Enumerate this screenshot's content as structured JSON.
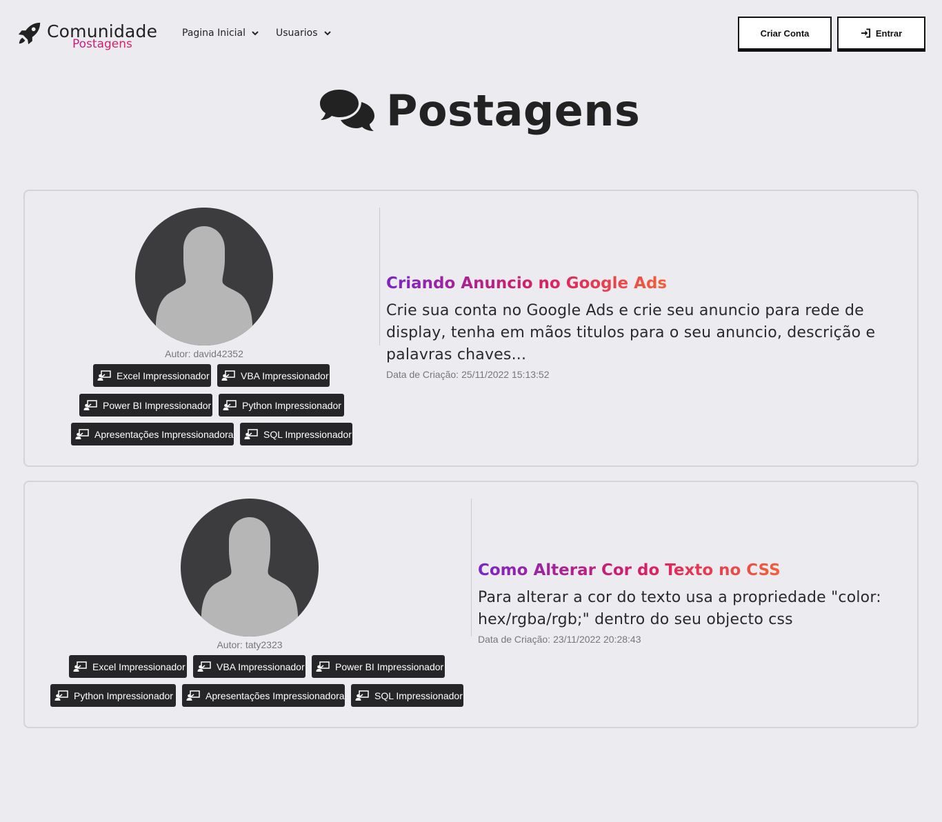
{
  "brand": {
    "name": "Comunidade",
    "subtitle": "Postagens",
    "icon": "rocket-icon"
  },
  "nav": {
    "items": [
      {
        "label": "Pagina Inicial",
        "icon": "chevron-down-icon"
      },
      {
        "label": "Usuarios",
        "icon": "chevron-down-icon"
      }
    ]
  },
  "header_buttons": {
    "create_account": "Criar Conta",
    "login": "Entrar",
    "login_icon": "sign-in-icon"
  },
  "page": {
    "title": "Postagens",
    "icon": "comments-icon"
  },
  "posts": [
    {
      "author_label": "Autor:",
      "author": "david42352",
      "title": "Criando Anuncio no Google Ads",
      "body": "Crie sua conta no Google Ads e crie seu anuncio para rede de display, tenha em mãos titulos para o seu anuncio, descrição e palavras chaves...",
      "date_label": "Data de Criação:",
      "date": "25/11/2022 15:13:52",
      "courses": [
        "Excel Impressionador",
        "VBA Impressionador",
        "Power BI Impressionador",
        "Python Impressionador",
        "Apresentações Impressionadora",
        "SQL Impressionador"
      ]
    },
    {
      "author_label": "Autor:",
      "author": "taty2323",
      "title": "Como Alterar Cor do Texto no CSS",
      "body": "Para alterar a cor do texto usa a propriedade \"color: hex/rgba/rgb;\" dentro do seu objecto css",
      "date_label": "Data de Criação:",
      "date": "23/11/2022 20:28:43",
      "courses": [
        "Excel Impressionador",
        "VBA Impressionador",
        "Power BI Impressionador",
        "Python Impressionador",
        "Apresentações Impressionadora",
        "SQL Impressionador"
      ]
    }
  ],
  "colors": {
    "background": "#ecebef",
    "badge": "#262628",
    "title_gradient": [
      "#7a26c6",
      "#d81f63",
      "#f2613b"
    ],
    "brand_sub": "#d11e6c"
  }
}
